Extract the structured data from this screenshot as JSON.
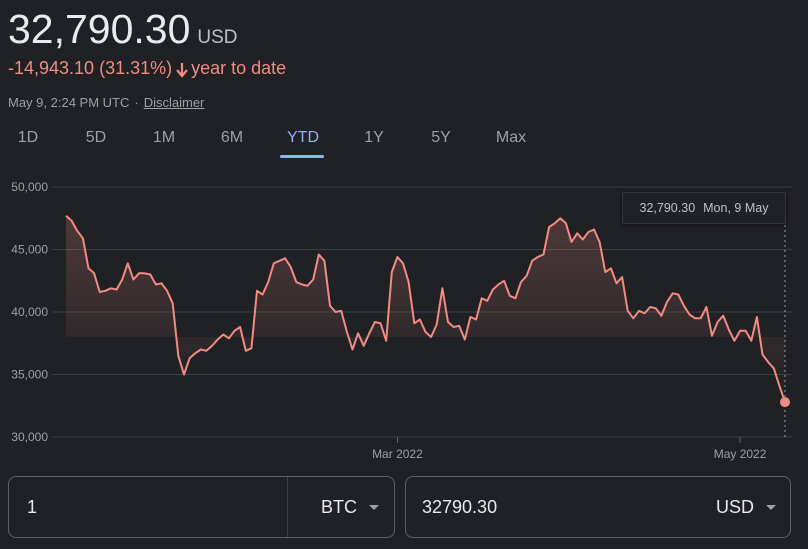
{
  "header": {
    "price": "32,790.30",
    "currency": "USD",
    "change": "-14,943.10 (31.31%)",
    "change_period": "year to date",
    "timestamp": "May 9, 2:24 PM UTC",
    "separator": "·",
    "disclaimer": "Disclaimer"
  },
  "colors": {
    "negative": "#f28b82",
    "accent": "#8ab4f8",
    "line": "#f28b82",
    "background": "#202124"
  },
  "tabs": [
    {
      "label": "1D"
    },
    {
      "label": "5D"
    },
    {
      "label": "1M"
    },
    {
      "label": "6M"
    },
    {
      "label": "YTD"
    },
    {
      "label": "1Y"
    },
    {
      "label": "5Y"
    },
    {
      "label": "Max"
    }
  ],
  "active_tab": "YTD",
  "tooltip": {
    "value": "32,790.30",
    "date": "Mon, 9 May"
  },
  "chart_data": {
    "type": "area",
    "title": "",
    "xlabel": "",
    "ylabel": "",
    "ylim": [
      30000,
      50000
    ],
    "yticks": [
      30000,
      35000,
      40000,
      45000,
      50000
    ],
    "ytick_labels": [
      "30,000",
      "35,000",
      "40,000",
      "45,000",
      "50,000"
    ],
    "xticks": [
      {
        "label": "Mar 2022",
        "date": "2022-03-01"
      },
      {
        "label": "May 2022",
        "date": "2022-05-01"
      }
    ],
    "grid": "horizontal",
    "series": [
      {
        "x": [
          "2022-01-01",
          "2022-01-02",
          "2022-01-03",
          "2022-01-04",
          "2022-01-05",
          "2022-01-06",
          "2022-01-07",
          "2022-01-08",
          "2022-01-09",
          "2022-01-10",
          "2022-01-11",
          "2022-01-12",
          "2022-01-13",
          "2022-01-14",
          "2022-01-15",
          "2022-01-16",
          "2022-01-17",
          "2022-01-18",
          "2022-01-19",
          "2022-01-20",
          "2022-01-21",
          "2022-01-22",
          "2022-01-23",
          "2022-01-24",
          "2022-01-25",
          "2022-01-26",
          "2022-01-27",
          "2022-01-28",
          "2022-01-29",
          "2022-01-30",
          "2022-01-31",
          "2022-02-01",
          "2022-02-02",
          "2022-02-03",
          "2022-02-04",
          "2022-02-05",
          "2022-02-06",
          "2022-02-07",
          "2022-02-08",
          "2022-02-09",
          "2022-02-10",
          "2022-02-11",
          "2022-02-12",
          "2022-02-13",
          "2022-02-14",
          "2022-02-15",
          "2022-02-16",
          "2022-02-17",
          "2022-02-18",
          "2022-02-19",
          "2022-02-20",
          "2022-02-21",
          "2022-02-22",
          "2022-02-23",
          "2022-02-24",
          "2022-02-25",
          "2022-02-26",
          "2022-02-27",
          "2022-02-28",
          "2022-03-01",
          "2022-03-02",
          "2022-03-03",
          "2022-03-04",
          "2022-03-05",
          "2022-03-06",
          "2022-03-07",
          "2022-03-08",
          "2022-03-09",
          "2022-03-10",
          "2022-03-11",
          "2022-03-12",
          "2022-03-13",
          "2022-03-14",
          "2022-03-15",
          "2022-03-16",
          "2022-03-17",
          "2022-03-18",
          "2022-03-19",
          "2022-03-20",
          "2022-03-21",
          "2022-03-22",
          "2022-03-23",
          "2022-03-24",
          "2022-03-25",
          "2022-03-26",
          "2022-03-27",
          "2022-03-28",
          "2022-03-29",
          "2022-03-30",
          "2022-03-31",
          "2022-04-01",
          "2022-04-02",
          "2022-04-03",
          "2022-04-04",
          "2022-04-05",
          "2022-04-06",
          "2022-04-07",
          "2022-04-08",
          "2022-04-09",
          "2022-04-10",
          "2022-04-11",
          "2022-04-12",
          "2022-04-13",
          "2022-04-14",
          "2022-04-15",
          "2022-04-16",
          "2022-04-17",
          "2022-04-18",
          "2022-04-19",
          "2022-04-20",
          "2022-04-21",
          "2022-04-22",
          "2022-04-23",
          "2022-04-24",
          "2022-04-25",
          "2022-04-26",
          "2022-04-27",
          "2022-04-28",
          "2022-04-29",
          "2022-04-30",
          "2022-05-01",
          "2022-05-02",
          "2022-05-03",
          "2022-05-04",
          "2022-05-05",
          "2022-05-06",
          "2022-05-07",
          "2022-05-08",
          "2022-05-09"
        ],
        "values": [
          47700,
          47300,
          46500,
          45900,
          43500,
          43100,
          41600,
          41700,
          41900,
          41800,
          42600,
          43900,
          42600,
          43100,
          43100,
          43000,
          42200,
          42300,
          41700,
          40700,
          36500,
          35000,
          36300,
          36700,
          37000,
          36900,
          37300,
          37800,
          38200,
          37900,
          38500,
          38800,
          36900,
          37100,
          41700,
          41400,
          42400,
          43900,
          44100,
          44300,
          43600,
          42400,
          42200,
          42100,
          42600,
          44600,
          44100,
          40500,
          40000,
          40100,
          38400,
          37000,
          38300,
          37300,
          38300,
          39200,
          39100,
          37700,
          43200,
          44400,
          43900,
          42400,
          39100,
          39400,
          38400,
          38000,
          39000,
          41900,
          39200,
          38800,
          38900,
          37800,
          39600,
          39400,
          41100,
          40900,
          41800,
          42200,
          42500,
          41300,
          41100,
          42400,
          42900,
          44100,
          44400,
          44600,
          46800,
          47100,
          47500,
          47100,
          45600,
          46300,
          45800,
          46400,
          46600,
          45600,
          43200,
          43500,
          42300,
          42800,
          40100,
          39500,
          40100,
          39900,
          40400,
          40300,
          39700,
          40800,
          41500,
          41400,
          40500,
          39800,
          39500,
          39500,
          40400,
          38100,
          39200,
          39700,
          38600,
          37700,
          38500,
          38500,
          37700,
          39600,
          36600,
          36000,
          35500,
          34100,
          32790.3
        ]
      }
    ]
  },
  "converter": {
    "from_value": "1",
    "from_unit": "BTC",
    "to_value": "32790.30",
    "to_unit": "USD"
  }
}
